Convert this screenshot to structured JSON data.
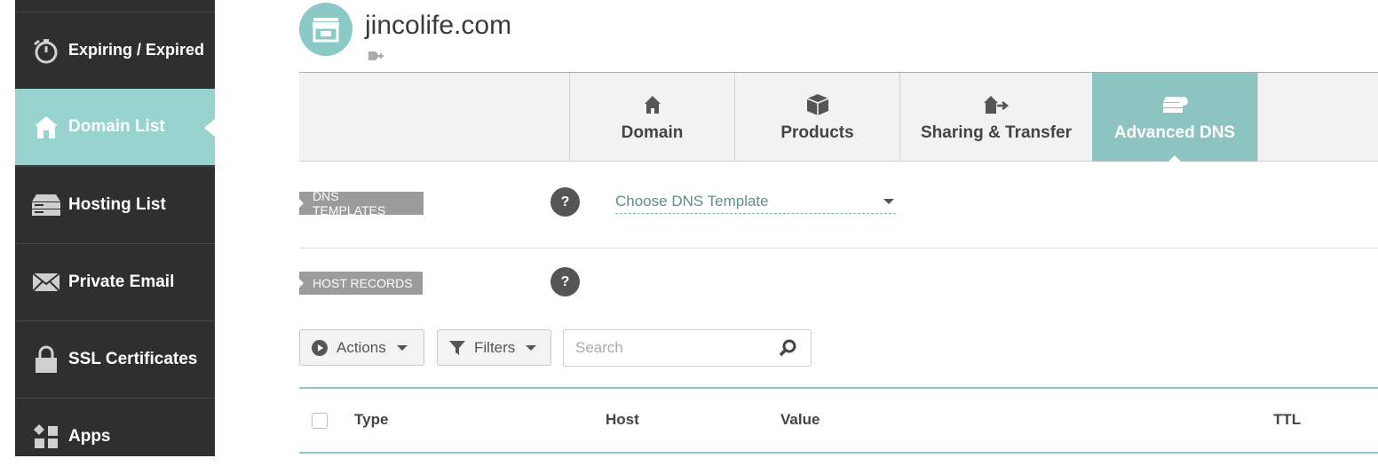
{
  "sidebar": {
    "items": [
      {
        "label": "",
        "icon": "menu-item-icon"
      },
      {
        "label": "Expiring / Expired",
        "icon": "stopwatch-icon"
      },
      {
        "label": "Domain List",
        "icon": "home-icon",
        "active": true
      },
      {
        "label": "Hosting List",
        "icon": "server-icon"
      },
      {
        "label": "Private Email",
        "icon": "envelope-icon"
      },
      {
        "label": "SSL Certificates",
        "icon": "lock-icon"
      },
      {
        "label": "Apps",
        "icon": "apps-icon"
      }
    ]
  },
  "header": {
    "domain": "jincolife.com",
    "avatar_icon": "storefront-icon",
    "tag_icon": "add-tag-icon"
  },
  "tabs": [
    {
      "label": "Domain",
      "icon": "home-icon"
    },
    {
      "label": "Products",
      "icon": "box-icon"
    },
    {
      "label": "Sharing & Transfer",
      "icon": "house-arrow-icon"
    },
    {
      "label": "Advanced DNS",
      "icon": "server-icon",
      "active": true
    }
  ],
  "dns_templates": {
    "label": "DNS TEMPLATES",
    "help": "?",
    "select_value": "Choose DNS Template"
  },
  "host_records": {
    "label": "HOST RECORDS",
    "help": "?"
  },
  "toolbar": {
    "actions_label": "Actions",
    "filters_label": "Filters",
    "search_placeholder": "Search"
  },
  "table": {
    "columns": [
      "Type",
      "Host",
      "Value",
      "TTL"
    ]
  },
  "colors": {
    "sidebar_bg": "#2f2f2f",
    "accent": "#8dc4c1",
    "section_label_bg": "#9b9b9b"
  }
}
